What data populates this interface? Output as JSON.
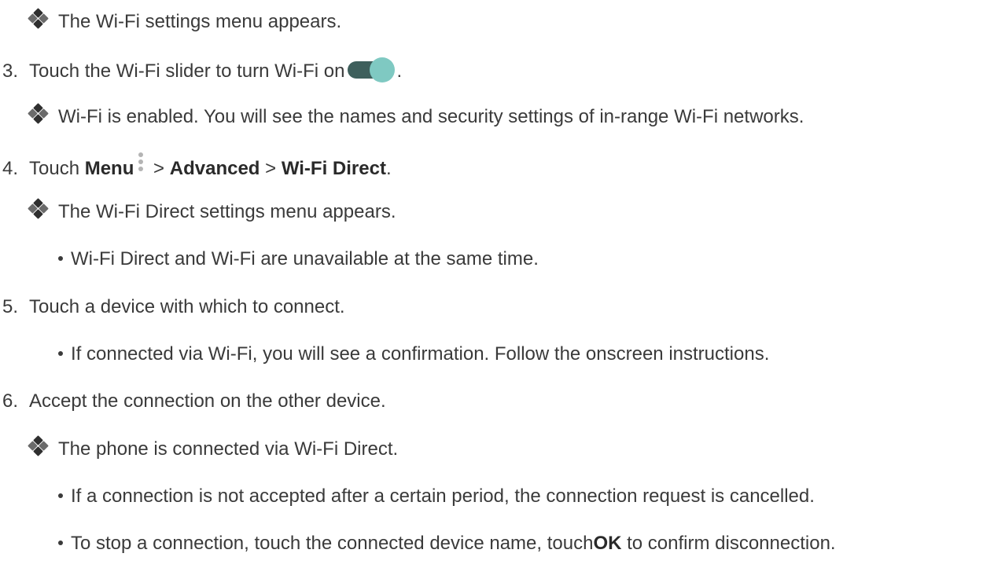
{
  "lines": {
    "l1": {
      "text": "The Wi-Fi settings menu appears."
    },
    "l2": {
      "num": "3.",
      "text": "Touch the Wi-Fi slider to turn Wi-Fi on",
      "after": "."
    },
    "l3": {
      "text": "Wi-Fi is enabled. You will see the names and security settings of in-range Wi-Fi networks."
    },
    "l4": {
      "num": "4.",
      "pre": "Touch ",
      "menu": "Menu",
      "sep1": " > ",
      "advanced": "Advanced",
      "sep2": " > ",
      "wifi_direct": "Wi-Fi Direct",
      "after": "."
    },
    "l5": {
      "text": "The Wi-Fi Direct settings menu appears."
    },
    "l6": {
      "text": "Wi-Fi Direct and Wi-Fi are unavailable at the same time."
    },
    "l7": {
      "num": "5.",
      "text": "Touch a device with which to connect."
    },
    "l8": {
      "text": "If connected via Wi-Fi, you will see a confirmation. Follow the onscreen instructions."
    },
    "l9": {
      "num": "6.",
      "text": "Accept the connection on the other device."
    },
    "l10": {
      "text": "The phone is connected via Wi-Fi Direct."
    },
    "l11": {
      "text": "If a connection is not accepted after a certain period, the connection request is cancelled."
    },
    "l12": {
      "pre": "To stop a connection, touch the connected device name, touch",
      "ok": "OK",
      "post": " to confirm disconnection."
    }
  },
  "icons": {
    "result": "result-diamond-icon",
    "toggle": "toggle-on-icon",
    "menu": "overflow-menu-icon"
  },
  "colors": {
    "text": "#3a3a3a",
    "toggle_track": "#3e5f5c",
    "toggle_knob": "#7fc9c2"
  }
}
